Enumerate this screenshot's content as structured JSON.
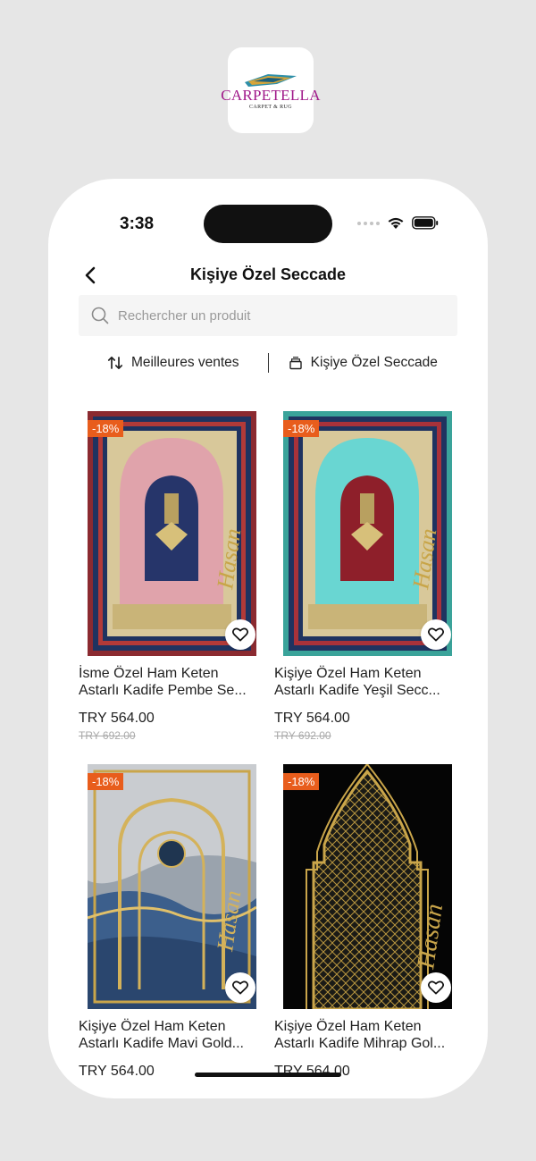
{
  "logo": {
    "name": "CARPETELLA",
    "subtitle": "CARPET & RUG"
  },
  "status_bar": {
    "time": "3:38"
  },
  "header": {
    "title": "Kişiye Özel Seccade"
  },
  "search": {
    "placeholder": "Rechercher un produit",
    "value": ""
  },
  "filters": {
    "sort_label": "Meilleures ventes",
    "category_label": "Kişiye Özel Seccade"
  },
  "products": [
    {
      "discount": "-18%",
      "name": "İsme Özel Ham Keten Astarlı Kadife Pembe Se...",
      "price": "TRY 564.00",
      "old_price": "TRY 692.00",
      "signature": "Hasan"
    },
    {
      "discount": "-18%",
      "name": "Kişiye Özel Ham Keten Astarlı Kadife Yeşil Secc...",
      "price": "TRY 564.00",
      "old_price": "TRY 692.00",
      "signature": "Hasan"
    },
    {
      "discount": "-18%",
      "name": "Kişiye Özel Ham Keten Astarlı Kadife Mavi Gold...",
      "price": "TRY 564.00",
      "signature": "Hasan"
    },
    {
      "discount": "-18%",
      "name": "Kişiye Özel Ham Keten Astarlı Kadife Mihrap Gol...",
      "price": "TRY 564.00",
      "signature": "Hasan"
    }
  ],
  "colors": {
    "accent_badge": "#e85d1c",
    "logo_brand": "#a0198a",
    "background": "#e6e6e6"
  }
}
